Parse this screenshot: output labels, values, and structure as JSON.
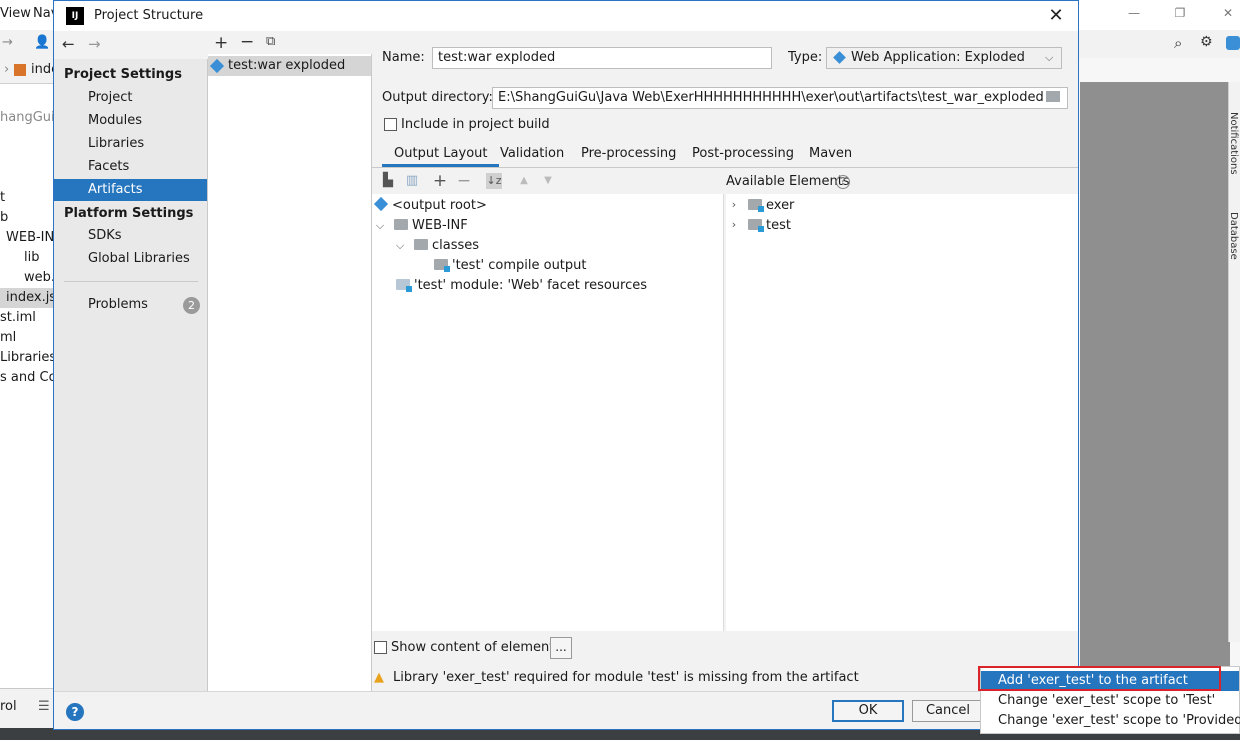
{
  "ide": {
    "menu": [
      "View",
      "Nav"
    ],
    "tab_label": "inde",
    "tree": [
      "hangGuiG",
      "t",
      "b",
      "WEB-INF",
      "lib",
      "web.",
      "index.jsp",
      "st.iml",
      "ml",
      "Libraries",
      "s and Con"
    ],
    "bottom_label": "rol",
    "right_tools": [
      "Notifications",
      "Database"
    ]
  },
  "dialog": {
    "title": "Project Structure",
    "nav": {
      "project_settings_header": "Project Settings",
      "project_settings_items": [
        "Project",
        "Modules",
        "Libraries",
        "Facets",
        "Artifacts"
      ],
      "selected_item": "Artifacts",
      "platform_settings_header": "Platform Settings",
      "platform_settings_items": [
        "SDKs",
        "Global Libraries"
      ],
      "problems_label": "Problems",
      "problems_count": "2"
    },
    "artifacts": {
      "items": [
        "test:war exploded"
      ]
    },
    "form": {
      "name_label": "Name:",
      "name_value": "test:war exploded",
      "type_label": "Type:",
      "type_value": "Web Application: Exploded",
      "output_dir_label": "Output directory:",
      "output_dir_value": "E:\\ShangGuiGu\\Java Web\\ExerHHHHHHHHHHH\\exer\\out\\artifacts\\test_war_exploded",
      "include_in_build_label": "Include in project build",
      "include_in_build_checked": false
    },
    "tabs": [
      "Output Layout",
      "Validation",
      "Pre-processing",
      "Post-processing",
      "Maven"
    ],
    "active_tab": "Output Layout",
    "layout_tree": {
      "root": "<output root>",
      "web_inf": "WEB-INF",
      "classes": "classes",
      "compile_output": "'test' compile output",
      "facet_resources": "'test' module: 'Web' facet resources"
    },
    "available": {
      "header": "Available Elements",
      "items": [
        "exer",
        "test"
      ]
    },
    "show_content_label": "Show content of elements",
    "ellipsis": "...",
    "warning": "Library 'exer_test' required for module 'test' is missing from the artifact",
    "ok_label": "OK",
    "cancel_label": "Cancel",
    "help": "?"
  },
  "popup": {
    "items": [
      "Add 'exer_test' to the artifact",
      "Change 'exer_test' scope to 'Test'",
      "Change 'exer_test' scope to 'Provided'"
    ],
    "selected_index": 0
  },
  "colors": {
    "accent": "#2675bf",
    "warning": "#e9a21c",
    "highlight_border": "#d9242b"
  }
}
